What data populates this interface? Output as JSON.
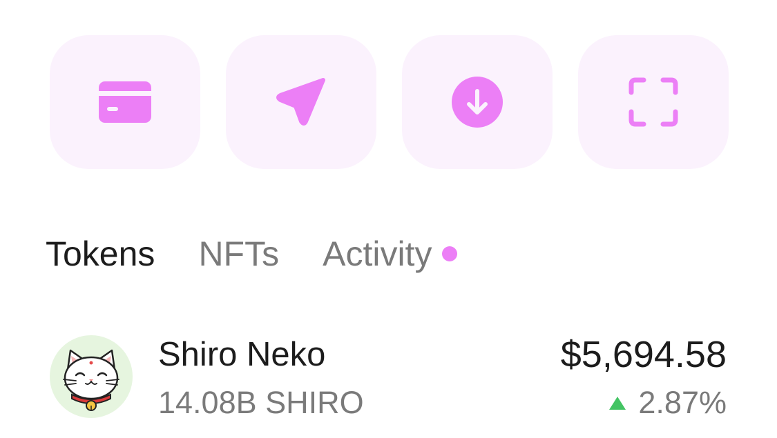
{
  "colors": {
    "accent": "#ec7ff6",
    "button_bg": "#fbf2fd",
    "text_primary": "#1c1c1c",
    "text_secondary": "#7a7a7a",
    "positive": "#43c463",
    "avatar_bg": "#e6f5df"
  },
  "actions": [
    {
      "icon": "credit-card-icon"
    },
    {
      "icon": "send-arrow-icon"
    },
    {
      "icon": "arrow-down-circle-icon"
    },
    {
      "icon": "scan-frame-icon"
    }
  ],
  "tabs": [
    {
      "label": "Tokens",
      "active": true
    },
    {
      "label": "NFTs",
      "active": false
    },
    {
      "label": "Activity",
      "active": false,
      "has_dot": true
    }
  ],
  "tokens": [
    {
      "name": "Shiro Neko",
      "balance": "14.08B SHIRO",
      "value": "$5,694.58",
      "change": "2.87%",
      "change_direction": "up",
      "icon": "shiro-neko-cat-avatar"
    }
  ]
}
